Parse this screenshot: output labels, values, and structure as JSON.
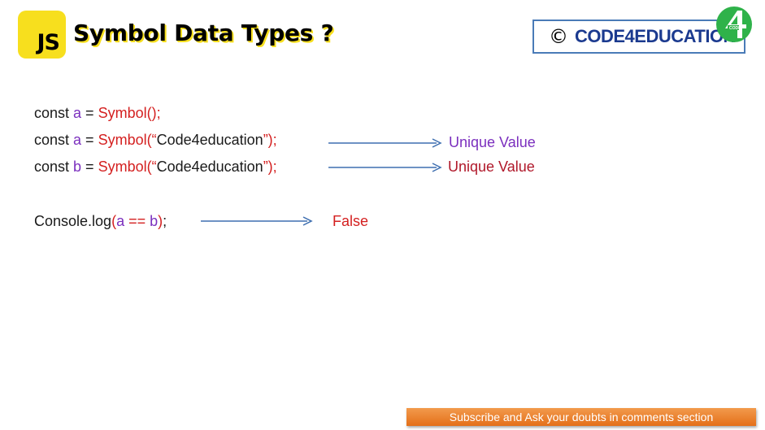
{
  "header": {
    "logo_text": "JS",
    "title": "Symbol Data Types ?"
  },
  "brand": {
    "copyright_symbol": "©",
    "name": "CODE4EDUCATION",
    "logo_icon": "code4education-logo-icon",
    "colors": {
      "text": "#1b3a8f",
      "border": "#4a7bb7",
      "logo": "#2fb24a"
    }
  },
  "code": {
    "line1": {
      "kw": "const ",
      "var": "a",
      "eq": " = ",
      "call": "Symbol();"
    },
    "line2": {
      "kw": "const ",
      "var": "a",
      "eq": " = ",
      "call": "Symbol(",
      "q1": "“",
      "arg": "Code4education",
      "q2": "”);"
    },
    "line3": {
      "kw": "const ",
      "var": "b",
      "eq": " = ",
      "call": "Symbol(",
      "q1": "“",
      "arg": "Code4education",
      "q2": "”);"
    },
    "line4": {
      "fn": "Console.log",
      "open": "(",
      "var_a": "a",
      "op": " == ",
      "var_b": "b",
      "close": ")",
      "end": ";"
    }
  },
  "results": {
    "r1": "Unique Value",
    "r2": "Unique Value",
    "r3": "False"
  },
  "colors": {
    "js_yellow": "#f7df1e",
    "variable": "#7b2fbe",
    "keyword_red": "#d42020",
    "result_purple": "#7b2fbe",
    "result_red": "#b0182a",
    "arrow": "#3f6fb0",
    "footer": "#e97b26"
  },
  "footer": {
    "text": "Subscribe and Ask your doubts in comments section"
  }
}
